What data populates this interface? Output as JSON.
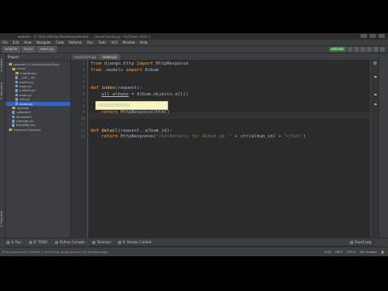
{
  "titlebar": {
    "title": "website - [C:\\Users\\Bucky\\Desktop\\website] - ...\\music\\views.py - PyCharm 2016.1"
  },
  "menu": {
    "items": [
      "File",
      "Edit",
      "View",
      "Navigate",
      "Code",
      "Refactor",
      "Run",
      "Tools",
      "VCS",
      "Window",
      "Help"
    ]
  },
  "nav": {
    "crumbs": [
      "website",
      "music",
      "views.py"
    ],
    "run_config": "website"
  },
  "left_tabs": {
    "project": "1: Project",
    "structure": "7: Structure",
    "favorites": "2: Favorites"
  },
  "project": {
    "header": "Project",
    "tree": [
      {
        "label": "website (C:\\Users\\Bucky\\Desk",
        "indent": 1,
        "kind": "folder"
      },
      {
        "label": "music",
        "indent": 2,
        "kind": "folder"
      },
      {
        "label": "migrations",
        "indent": 3,
        "kind": "folder"
      },
      {
        "label": "__init__.py",
        "indent": 3,
        "kind": "file"
      },
      {
        "label": "admin.py",
        "indent": 3,
        "kind": "file"
      },
      {
        "label": "apps.py",
        "indent": 3,
        "kind": "file"
      },
      {
        "label": "models.py",
        "indent": 3,
        "kind": "file"
      },
      {
        "label": "tests.py",
        "indent": 3,
        "kind": "file"
      },
      {
        "label": "urls.py",
        "indent": 3,
        "kind": "file"
      },
      {
        "label": "views.py",
        "indent": 3,
        "kind": "file",
        "selected": true
      },
      {
        "label": "website",
        "indent": 2,
        "kind": "folder"
      },
      {
        "label": ".gitignore",
        "indent": 2,
        "kind": "file"
      },
      {
        "label": "db.sqlite3",
        "indent": 2,
        "kind": "file"
      },
      {
        "label": "manage.py",
        "indent": 2,
        "kind": "file"
      },
      {
        "label": "README.md",
        "indent": 2,
        "kind": "file"
      },
      {
        "label": "External Libraries",
        "indent": 1,
        "kind": "folder"
      }
    ]
  },
  "editor": {
    "tabs": [
      "music\\urls.py",
      "views.py"
    ],
    "line_numbers": [
      "1",
      "2",
      "3",
      "4",
      "5",
      "6",
      "7",
      "8",
      "9",
      "10",
      "11",
      "12",
      "13"
    ]
  },
  "bottom_tools": {
    "run": "4: Run",
    "todo": "6: TODO",
    "python_console": "Python Console",
    "terminal": "Terminal",
    "version_control": "9: Version Control",
    "event_log": "Event Log"
  },
  "status": {
    "message": "Push successful: Pushed 1 commit to origin/master (28 minutes ago)",
    "position": "5:25",
    "line_sep": "CRLF",
    "encoding": "UTF-8",
    "git": "Git: master"
  }
}
